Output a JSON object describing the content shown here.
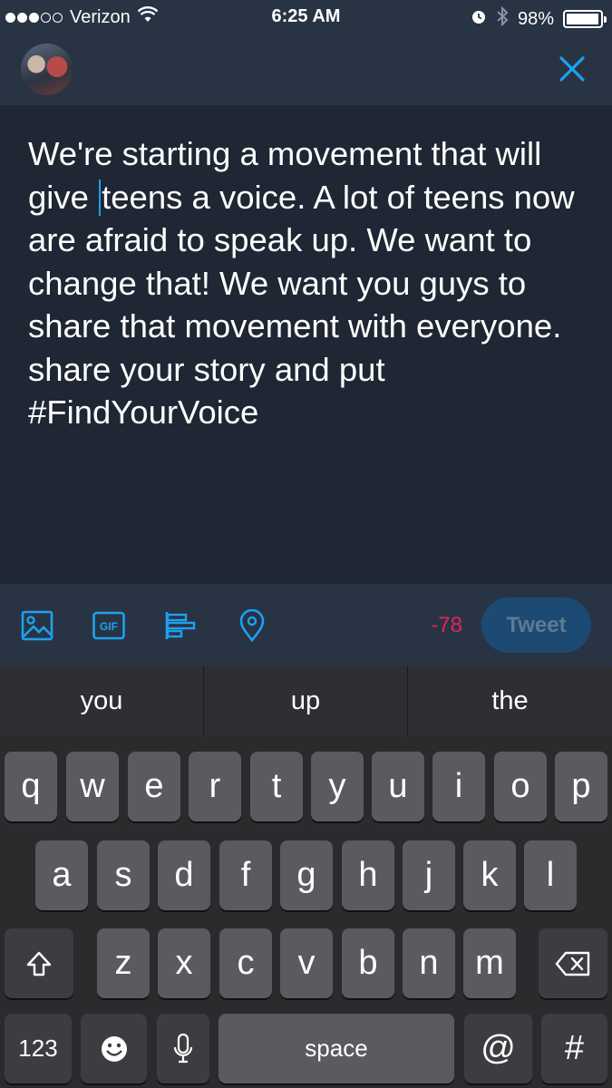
{
  "status_bar": {
    "carrier": "Verizon",
    "time": "6:25 AM",
    "battery": "98%",
    "battery_level": 0.98,
    "signal_bars": 3,
    "signal_total": 5
  },
  "compose": {
    "tweet_text_before_cursor": "We're starting a movement that will give ",
    "tweet_text_after_cursor": "teens a voice. A lot of teens now are afraid to speak up. We want to change that! We want you guys to share that movement with everyone. share your story and put #FindYourVoice",
    "char_count": "-78",
    "tweet_button_label": "Tweet"
  },
  "colors": {
    "accent": "#1da1f2",
    "char_count_over": "#e0245e",
    "background": "#1e2733"
  },
  "icons": [
    "wifi-icon",
    "alarm-icon",
    "bluetooth-icon",
    "close-icon",
    "image-icon",
    "gif-icon",
    "poll-icon",
    "location-icon",
    "shift-icon",
    "backspace-icon",
    "emoji-icon",
    "microphone-icon"
  ],
  "keyboard": {
    "suggestions": [
      "you",
      "up",
      "the"
    ],
    "row1": [
      "q",
      "w",
      "e",
      "r",
      "t",
      "y",
      "u",
      "i",
      "o",
      "p"
    ],
    "row2": [
      "a",
      "s",
      "d",
      "f",
      "g",
      "h",
      "j",
      "k",
      "l"
    ],
    "row3": [
      "z",
      "x",
      "c",
      "v",
      "b",
      "n",
      "m"
    ],
    "numbers_label": "123",
    "space_label": "space",
    "at_label": "@",
    "hash_label": "#",
    "gif_label": "GIF"
  }
}
